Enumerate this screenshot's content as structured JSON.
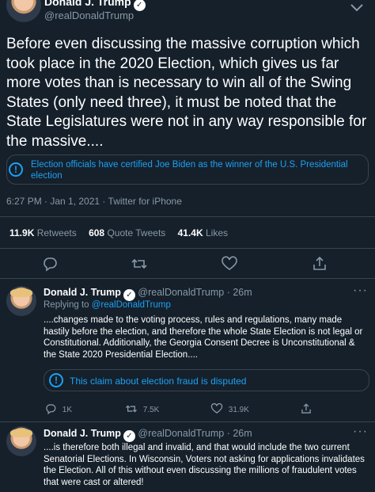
{
  "main_tweet": {
    "author_name": "Donald J. Trump",
    "handle": "@realDonaldTrump",
    "body": "Before even discussing the massive corruption which took place in the 2020 Election, which gives us far more votes than is necessary to win all of the Swing States (only need three), it must be noted that the State Legislatures were not in any way responsible for the massive....",
    "notice": "Election officials have certified Joe Biden as the winner of the U.S. Presidential election",
    "meta": "6:27 PM · Jan 1, 2021 · Twitter for iPhone",
    "stats": {
      "retweets_count": "11.9K",
      "retweets_label": "Retweets",
      "quote_count": "608",
      "quote_label": "Quote Tweets",
      "likes_count": "41.4K",
      "likes_label": "Likes"
    }
  },
  "replies": [
    {
      "author_name": "Donald J. Trump",
      "handle": "@realDonaldTrump",
      "time": "· 26m",
      "replying_to_prefix": "Replying to",
      "replying_to": "@realDonaldTrump",
      "body": "....changes made to the voting process, rules and regulations, many made hastily before the election, and therefore the whole State Election is not legal or Constitutional. Additionally, the Georgia Consent Decree is Unconstitutional & the State 2020 Presidential Election....",
      "notice": "This claim about election fraud is disputed",
      "reply_count": "1K",
      "retweet_count": "7.5K",
      "like_count": "31.9K"
    },
    {
      "author_name": "Donald J. Trump",
      "handle": "@realDonaldTrump",
      "time": "· 26m",
      "body": "....is therefore both illegal and invalid, and that would include the two current Senatorial Elections. In Wisconsin, Voters not asking for applications invalidates the Election. All of this without even discussing the millions of fraudulent votes that were cast or altered!"
    }
  ],
  "icons": {
    "verified": "verified-badge-icon",
    "info": "info-icon",
    "reply": "reply-icon",
    "retweet": "retweet-icon",
    "like": "heart-icon",
    "share": "share-icon",
    "more": "more-dots-icon"
  },
  "colors": {
    "background": "#15202b",
    "accent": "#1da1f2",
    "muted": "#8899a6",
    "divider": "#38444d"
  }
}
